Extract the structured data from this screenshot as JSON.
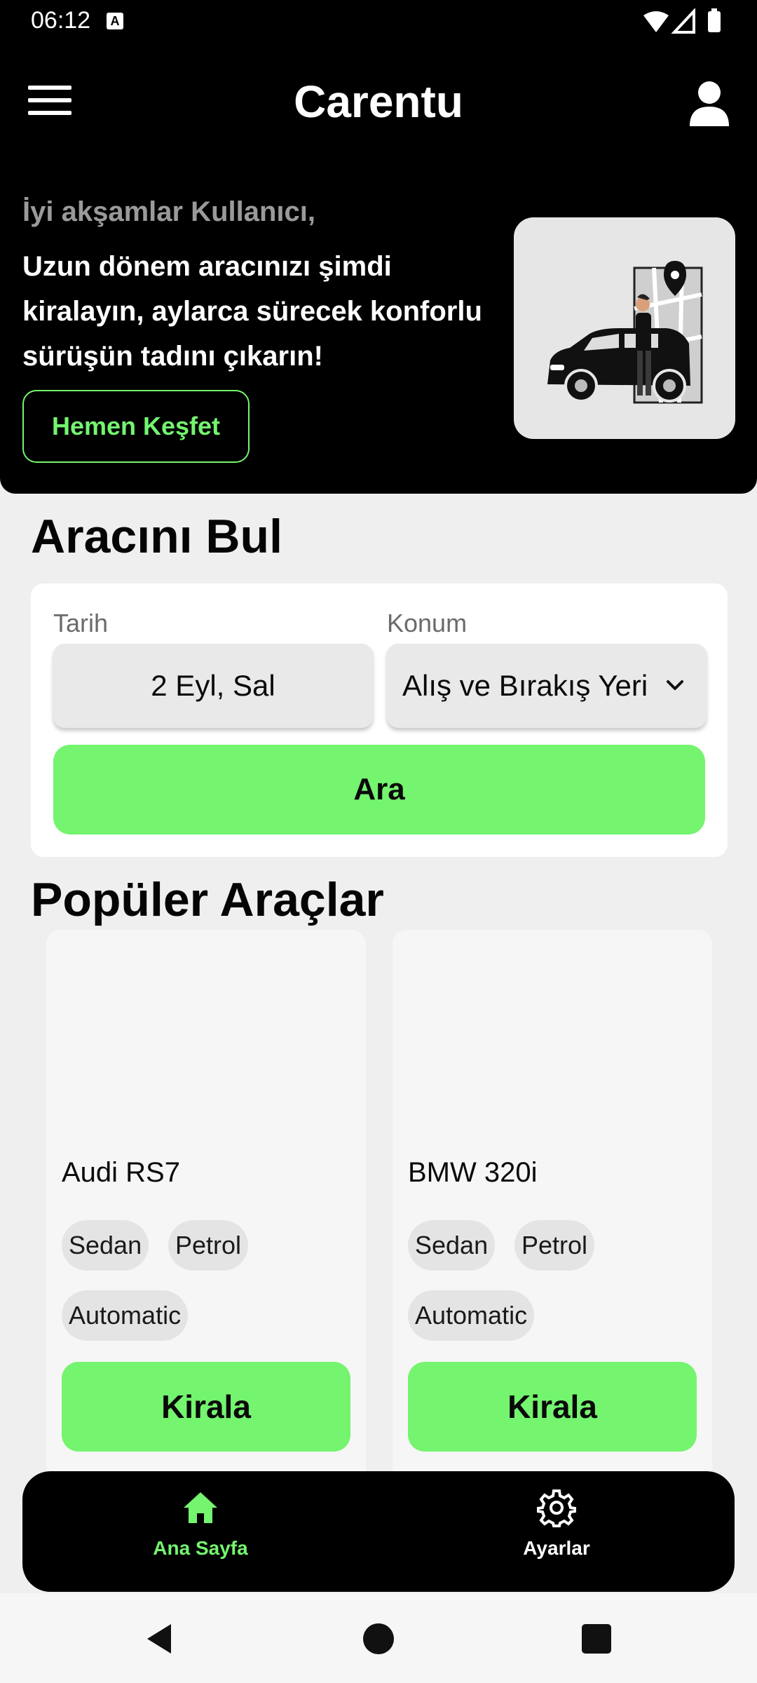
{
  "status_bar": {
    "time": "06:12",
    "notification_letter": "A"
  },
  "header": {
    "title": "Carentu"
  },
  "hero": {
    "greeting": "İyi akşamlar Kullanıcı,",
    "message": "Uzun dönem aracınızı şimdi kiralayın, aylarca sürecek konforlu sürüşün tadını çıkarın!",
    "cta_label": "Hemen Keşfet"
  },
  "find_car": {
    "title": "Aracını Bul",
    "date_label": "Tarih",
    "date_value": "2 Eyl, Sal",
    "location_label": "Konum",
    "location_value": "Alış ve Bırakış Yeri",
    "search_label": "Ara"
  },
  "popular": {
    "title": "Popüler Araçlar",
    "cars": [
      {
        "name": "Audi RS7",
        "tags": [
          "Sedan",
          "Petrol",
          "Automatic"
        ],
        "rent_label": "Kirala"
      },
      {
        "name": "BMW 320i",
        "tags": [
          "Sedan",
          "Petrol",
          "Automatic"
        ],
        "rent_label": "Kirala"
      }
    ]
  },
  "bottom_nav": {
    "items": [
      {
        "label": "Ana Sayfa",
        "icon": "home-icon",
        "active": true
      },
      {
        "label": "Ayarlar",
        "icon": "gear-icon",
        "active": false
      }
    ]
  },
  "colors": {
    "accent": "#74f46f",
    "background": "#efefef",
    "dark": "#000000"
  }
}
